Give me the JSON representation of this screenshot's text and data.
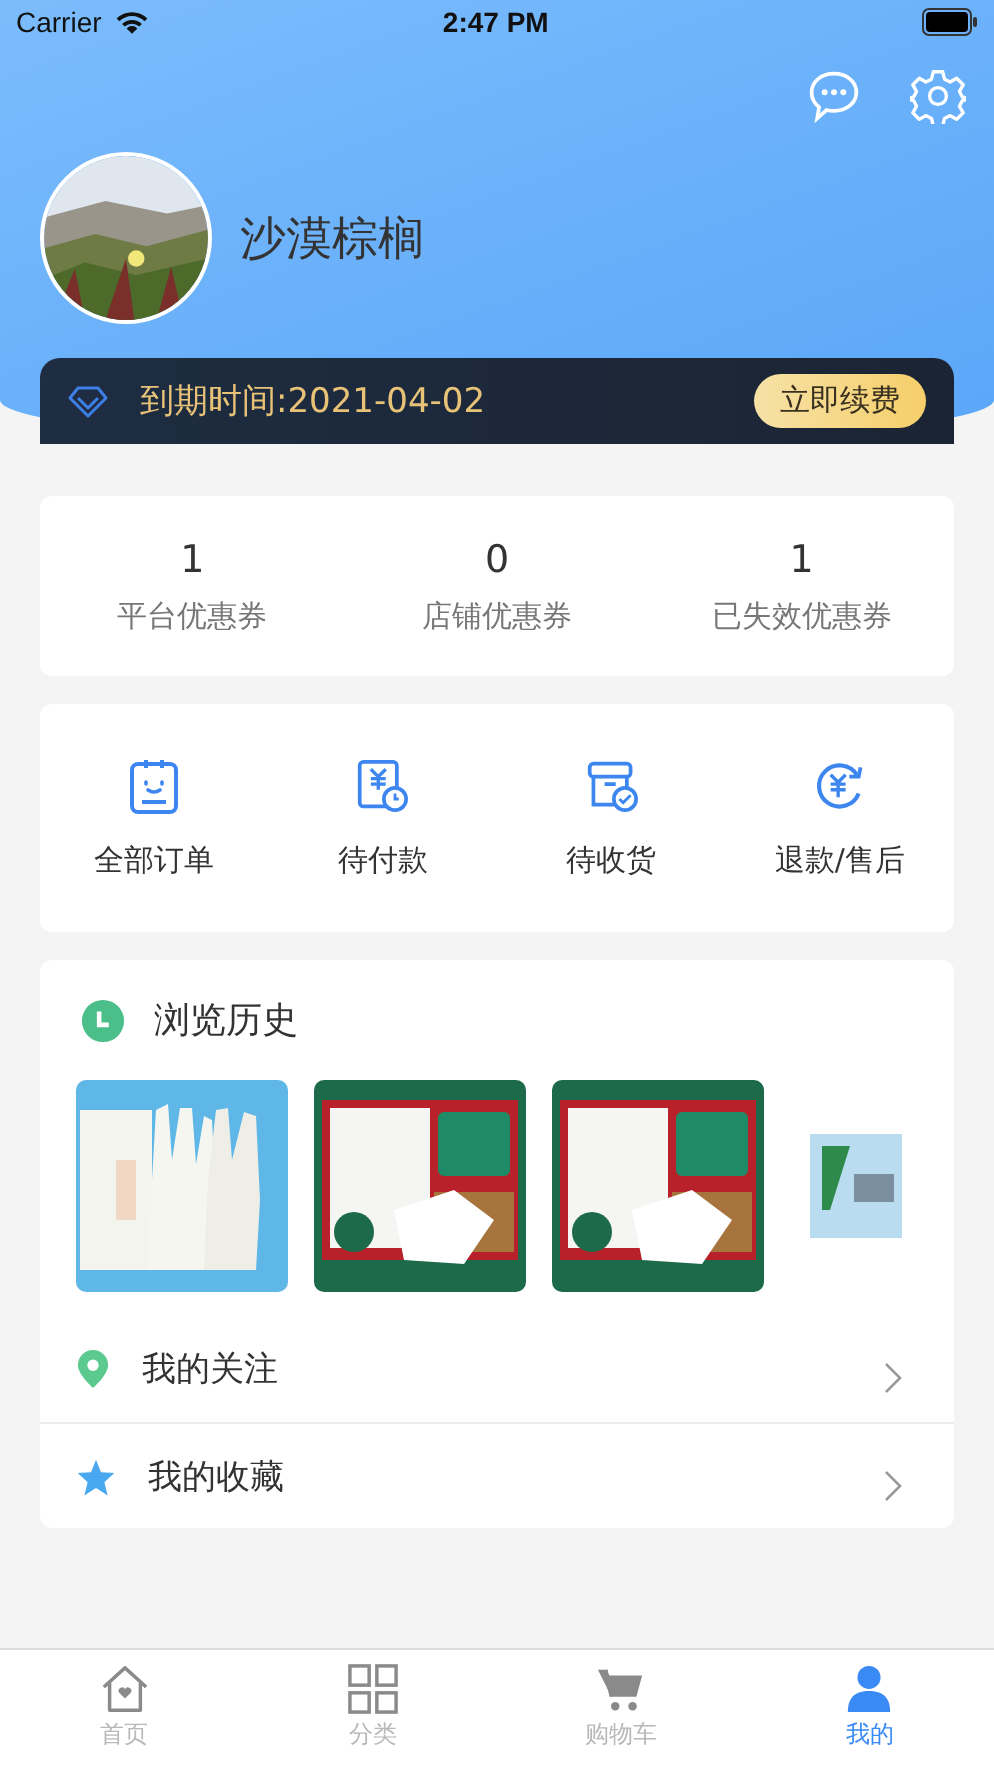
{
  "status_bar": {
    "carrier": "Carrier",
    "time": "2:47 PM"
  },
  "profile": {
    "name": "沙漠棕榈"
  },
  "membership": {
    "expiry": "到期时间:2021-04-02",
    "renew_button": "立即续费"
  },
  "coupons": [
    {
      "count": "1",
      "label": "平台优惠券"
    },
    {
      "count": "0",
      "label": "店铺优惠券"
    },
    {
      "count": "1",
      "label": "已失效优惠券"
    }
  ],
  "orders": [
    {
      "label": "全部订单"
    },
    {
      "label": "待付款"
    },
    {
      "label": "待收货"
    },
    {
      "label": "退款/售后"
    }
  ],
  "history": {
    "title": "浏览历史",
    "items": [
      {
        "kind": "gloves"
      },
      {
        "kind": "mask"
      },
      {
        "kind": "mask"
      },
      {
        "kind": "packet"
      }
    ]
  },
  "links": [
    {
      "label": "我的关注"
    },
    {
      "label": "我的收藏"
    }
  ],
  "tab_bar": [
    {
      "label": "首页",
      "selected": false
    },
    {
      "label": "分类",
      "selected": false
    },
    {
      "label": "购物车",
      "selected": false
    },
    {
      "label": "我的",
      "selected": true
    }
  ]
}
